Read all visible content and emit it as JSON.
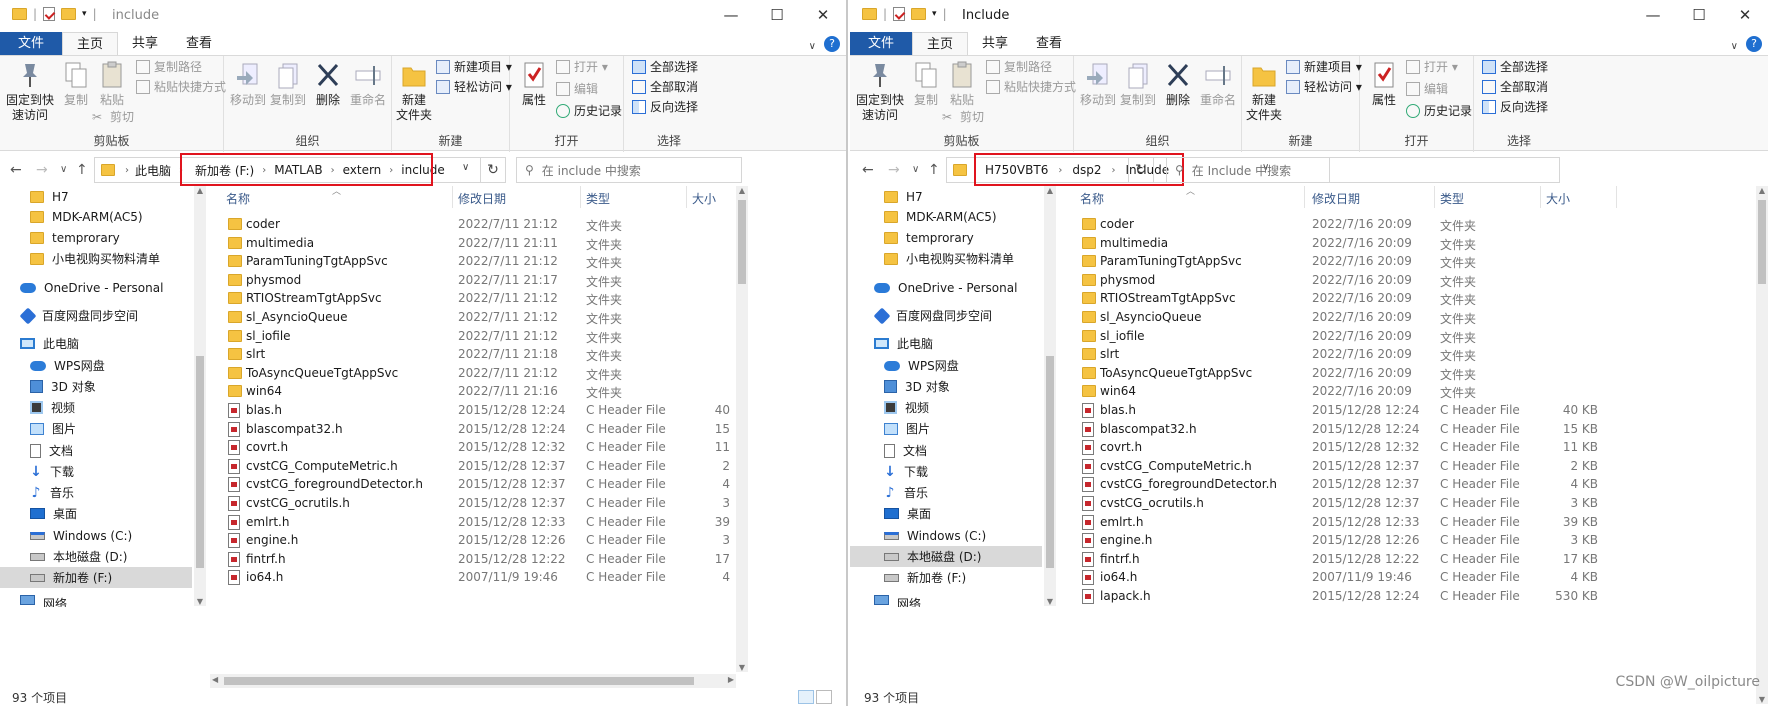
{
  "left": {
    "title": "include",
    "ribbon_tabs": [
      "文件",
      "主页",
      "共享",
      "查看"
    ],
    "clipboard": {
      "pin_label": "固定到快\n速访问",
      "copy": "复制",
      "paste": "粘贴",
      "copy_path": "复制路径",
      "paste_shortcut": "粘贴快捷方式",
      "cut": "剪切",
      "group": "剪贴板"
    },
    "organize": {
      "move_to": "移动到",
      "copy_to": "复制到",
      "delete": "删除",
      "rename": "重命名",
      "group": "组织"
    },
    "new": {
      "new_folder": "新建\n文件夹",
      "new_item": "新建项目 ▾",
      "easy_access": "轻松访问 ▾",
      "group": "新建"
    },
    "open": {
      "properties": "属性",
      "open": "打开 ▾",
      "edit": "编辑",
      "history": "历史记录",
      "group": "打开"
    },
    "select": {
      "select_all": "全部选择",
      "select_none": "全部取消",
      "invert": "反向选择",
      "group": "选择"
    },
    "breadcrumb": [
      "此电脑",
      "新加卷 (F:)",
      "MATLAB",
      "extern",
      "include"
    ],
    "search_placeholder": "在 include 中搜索",
    "nav": [
      {
        "label": "H7",
        "icon": "folder-icon"
      },
      {
        "label": "MDK-ARM(AC5)",
        "icon": "folder-icon"
      },
      {
        "label": "temprorary",
        "icon": "folder-icon"
      },
      {
        "label": "小电视购买物料清单",
        "icon": "folder-icon"
      },
      {
        "label": "OneDrive - Personal",
        "icon": "onedrive-icon"
      },
      {
        "label": "百度网盘同步空间",
        "icon": "baidu-icon"
      },
      {
        "label": "此电脑",
        "icon": "pc-icon"
      },
      {
        "label": "WPS网盘",
        "icon": "wps-icon"
      },
      {
        "label": "3D 对象",
        "icon": "3d-objects-icon"
      },
      {
        "label": "视频",
        "icon": "video-icon"
      },
      {
        "label": "图片",
        "icon": "pictures-icon"
      },
      {
        "label": "文档",
        "icon": "documents-icon"
      },
      {
        "label": "下载",
        "icon": "downloads-icon"
      },
      {
        "label": "音乐",
        "icon": "music-icon"
      },
      {
        "label": "桌面",
        "icon": "desktop-icon"
      },
      {
        "label": "Windows (C:)",
        "icon": "windows-drive-icon"
      },
      {
        "label": "本地磁盘 (D:)",
        "icon": "drive-icon"
      },
      {
        "label": "新加卷 (F:)",
        "icon": "drive-icon"
      },
      {
        "label": "网络",
        "icon": "network-icon"
      }
    ],
    "columns": [
      "名称",
      "修改日期",
      "类型",
      "大小"
    ],
    "files": [
      {
        "name": "coder",
        "date": "2022/7/11 21:12",
        "type": "文件夹",
        "size": "",
        "kind": "folder"
      },
      {
        "name": "multimedia",
        "date": "2022/7/11 21:11",
        "type": "文件夹",
        "size": "",
        "kind": "folder"
      },
      {
        "name": "ParamTuningTgtAppSvc",
        "date": "2022/7/11 21:12",
        "type": "文件夹",
        "size": "",
        "kind": "folder"
      },
      {
        "name": "physmod",
        "date": "2022/7/11 21:17",
        "type": "文件夹",
        "size": "",
        "kind": "folder"
      },
      {
        "name": "RTIOStreamTgtAppSvc",
        "date": "2022/7/11 21:12",
        "type": "文件夹",
        "size": "",
        "kind": "folder"
      },
      {
        "name": "sl_AsyncioQueue",
        "date": "2022/7/11 21:12",
        "type": "文件夹",
        "size": "",
        "kind": "folder"
      },
      {
        "name": "sl_iofile",
        "date": "2022/7/11 21:12",
        "type": "文件夹",
        "size": "",
        "kind": "folder"
      },
      {
        "name": "slrt",
        "date": "2022/7/11 21:18",
        "type": "文件夹",
        "size": "",
        "kind": "folder"
      },
      {
        "name": "ToAsyncQueueTgtAppSvc",
        "date": "2022/7/11 21:12",
        "type": "文件夹",
        "size": "",
        "kind": "folder"
      },
      {
        "name": "win64",
        "date": "2022/7/11 21:16",
        "type": "文件夹",
        "size": "",
        "kind": "folder"
      },
      {
        "name": "blas.h",
        "date": "2015/12/28 12:24",
        "type": "C Header File",
        "size": "40",
        "kind": "header"
      },
      {
        "name": "blascompat32.h",
        "date": "2015/12/28 12:24",
        "type": "C Header File",
        "size": "15",
        "kind": "header"
      },
      {
        "name": "covrt.h",
        "date": "2015/12/28 12:32",
        "type": "C Header File",
        "size": "11",
        "kind": "header"
      },
      {
        "name": "cvstCG_ComputeMetric.h",
        "date": "2015/12/28 12:37",
        "type": "C Header File",
        "size": "2",
        "kind": "header"
      },
      {
        "name": "cvstCG_foregroundDetector.h",
        "date": "2015/12/28 12:37",
        "type": "C Header File",
        "size": "4",
        "kind": "header"
      },
      {
        "name": "cvstCG_ocrutils.h",
        "date": "2015/12/28 12:37",
        "type": "C Header File",
        "size": "3",
        "kind": "header"
      },
      {
        "name": "emlrt.h",
        "date": "2015/12/28 12:33",
        "type": "C Header File",
        "size": "39",
        "kind": "header"
      },
      {
        "name": "engine.h",
        "date": "2015/12/28 12:26",
        "type": "C Header File",
        "size": "3",
        "kind": "header"
      },
      {
        "name": "fintrf.h",
        "date": "2015/12/28 12:22",
        "type": "C Header File",
        "size": "17",
        "kind": "header"
      },
      {
        "name": "io64.h",
        "date": "2007/11/9 19:46",
        "type": "C Header File",
        "size": "4",
        "kind": "header"
      }
    ],
    "status": "93 个项目"
  },
  "right": {
    "title": "Include",
    "ribbon_tabs": [
      "文件",
      "主页",
      "共享",
      "查看"
    ],
    "clipboard": {
      "pin_label": "固定到快\n速访问",
      "copy": "复制",
      "paste": "粘贴",
      "copy_path": "复制路径",
      "paste_shortcut": "粘贴快捷方式",
      "cut": "剪切",
      "group": "剪贴板"
    },
    "organize": {
      "move_to": "移动到",
      "copy_to": "复制到",
      "delete": "删除",
      "rename": "重命名",
      "group": "组织"
    },
    "new": {
      "new_folder": "新建\n文件夹",
      "new_item": "新建项目 ▾",
      "easy_access": "轻松访问 ▾",
      "group": "新建"
    },
    "open": {
      "properties": "属性",
      "open": "打开 ▾",
      "edit": "编辑",
      "history": "历史记录",
      "group": "打开"
    },
    "select": {
      "select_all": "全部选择",
      "select_none": "全部取消",
      "invert": "反向选择",
      "group": "选择"
    },
    "breadcrumb": [
      "H750VBT6",
      "dsp2",
      "Include"
    ],
    "search_placeholder": "在 Include 中搜索",
    "nav": [
      {
        "label": "H7",
        "icon": "folder-icon"
      },
      {
        "label": "MDK-ARM(AC5)",
        "icon": "folder-icon"
      },
      {
        "label": "temprorary",
        "icon": "folder-icon"
      },
      {
        "label": "小电视购买物料清单",
        "icon": "folder-icon"
      },
      {
        "label": "OneDrive - Personal",
        "icon": "onedrive-icon"
      },
      {
        "label": "百度网盘同步空间",
        "icon": "baidu-icon"
      },
      {
        "label": "此电脑",
        "icon": "pc-icon"
      },
      {
        "label": "WPS网盘",
        "icon": "wps-icon"
      },
      {
        "label": "3D 对象",
        "icon": "3d-objects-icon"
      },
      {
        "label": "视频",
        "icon": "video-icon"
      },
      {
        "label": "图片",
        "icon": "pictures-icon"
      },
      {
        "label": "文档",
        "icon": "documents-icon"
      },
      {
        "label": "下载",
        "icon": "downloads-icon"
      },
      {
        "label": "音乐",
        "icon": "music-icon"
      },
      {
        "label": "桌面",
        "icon": "desktop-icon"
      },
      {
        "label": "Windows (C:)",
        "icon": "windows-drive-icon"
      },
      {
        "label": "本地磁盘 (D:)",
        "icon": "drive-icon"
      },
      {
        "label": "新加卷 (F:)",
        "icon": "drive-icon"
      },
      {
        "label": "网络",
        "icon": "network-icon"
      }
    ],
    "columns": [
      "名称",
      "修改日期",
      "类型",
      "大小"
    ],
    "files": [
      {
        "name": "coder",
        "date": "2022/7/16 20:09",
        "type": "文件夹",
        "size": "",
        "kind": "folder"
      },
      {
        "name": "multimedia",
        "date": "2022/7/16 20:09",
        "type": "文件夹",
        "size": "",
        "kind": "folder"
      },
      {
        "name": "ParamTuningTgtAppSvc",
        "date": "2022/7/16 20:09",
        "type": "文件夹",
        "size": "",
        "kind": "folder"
      },
      {
        "name": "physmod",
        "date": "2022/7/16 20:09",
        "type": "文件夹",
        "size": "",
        "kind": "folder"
      },
      {
        "name": "RTIOStreamTgtAppSvc",
        "date": "2022/7/16 20:09",
        "type": "文件夹",
        "size": "",
        "kind": "folder"
      },
      {
        "name": "sl_AsyncioQueue",
        "date": "2022/7/16 20:09",
        "type": "文件夹",
        "size": "",
        "kind": "folder"
      },
      {
        "name": "sl_iofile",
        "date": "2022/7/16 20:09",
        "type": "文件夹",
        "size": "",
        "kind": "folder"
      },
      {
        "name": "slrt",
        "date": "2022/7/16 20:09",
        "type": "文件夹",
        "size": "",
        "kind": "folder"
      },
      {
        "name": "ToAsyncQueueTgtAppSvc",
        "date": "2022/7/16 20:09",
        "type": "文件夹",
        "size": "",
        "kind": "folder"
      },
      {
        "name": "win64",
        "date": "2022/7/16 20:09",
        "type": "文件夹",
        "size": "",
        "kind": "folder"
      },
      {
        "name": "blas.h",
        "date": "2015/12/28 12:24",
        "type": "C Header File",
        "size": "40 KB",
        "kind": "header"
      },
      {
        "name": "blascompat32.h",
        "date": "2015/12/28 12:24",
        "type": "C Header File",
        "size": "15 KB",
        "kind": "header"
      },
      {
        "name": "covrt.h",
        "date": "2015/12/28 12:32",
        "type": "C Header File",
        "size": "11 KB",
        "kind": "header"
      },
      {
        "name": "cvstCG_ComputeMetric.h",
        "date": "2015/12/28 12:37",
        "type": "C Header File",
        "size": "2 KB",
        "kind": "header"
      },
      {
        "name": "cvstCG_foregroundDetector.h",
        "date": "2015/12/28 12:37",
        "type": "C Header File",
        "size": "4 KB",
        "kind": "header"
      },
      {
        "name": "cvstCG_ocrutils.h",
        "date": "2015/12/28 12:37",
        "type": "C Header File",
        "size": "3 KB",
        "kind": "header"
      },
      {
        "name": "emlrt.h",
        "date": "2015/12/28 12:33",
        "type": "C Header File",
        "size": "39 KB",
        "kind": "header"
      },
      {
        "name": "engine.h",
        "date": "2015/12/28 12:26",
        "type": "C Header File",
        "size": "3 KB",
        "kind": "header"
      },
      {
        "name": "fintrf.h",
        "date": "2015/12/28 12:22",
        "type": "C Header File",
        "size": "17 KB",
        "kind": "header"
      },
      {
        "name": "io64.h",
        "date": "2007/11/9 19:46",
        "type": "C Header File",
        "size": "4 KB",
        "kind": "header"
      },
      {
        "name": "lapack.h",
        "date": "2015/12/28 12:24",
        "type": "C Header File",
        "size": "530 KB",
        "kind": "header"
      }
    ],
    "status": "93 个项目"
  },
  "watermark": "CSDN @W_oilpicture",
  "colors": {
    "accent": "#1f5aa8",
    "highlight_box": "#e0141e",
    "selection": "#cce4f7"
  }
}
